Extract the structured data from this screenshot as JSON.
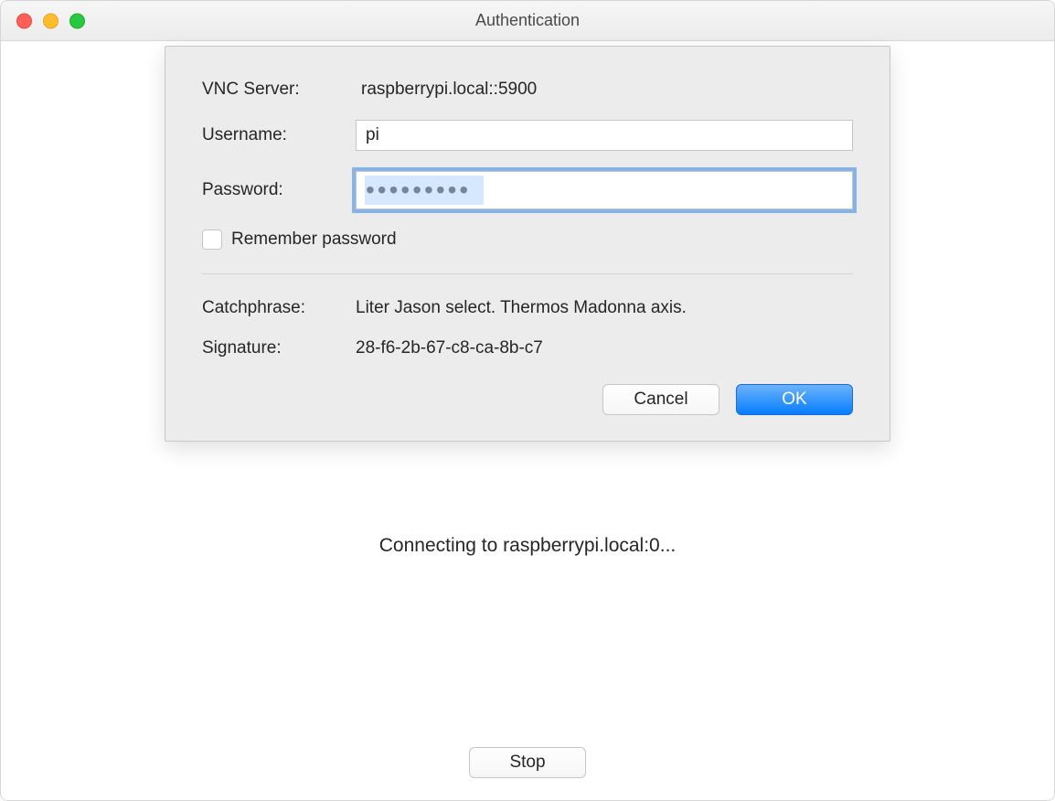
{
  "window": {
    "title": "Authentication"
  },
  "dialog": {
    "vnc_server_label": "VNC Server:",
    "vnc_server_value": "raspberrypi.local::5900",
    "username_label": "Username:",
    "username_value": "pi",
    "password_label": "Password:",
    "password_value": "•••••••••",
    "remember_password_label": "Remember password",
    "catchphrase_label": "Catchphrase:",
    "catchphrase_value": "Liter Jason select. Thermos Madonna axis.",
    "signature_label": "Signature:",
    "signature_value": "28-f6-2b-67-c8-ca-8b-c7",
    "cancel_label": "Cancel",
    "ok_label": "OK"
  },
  "status": {
    "connecting_text": "Connecting to raspberrypi.local:0...",
    "stop_label": "Stop"
  }
}
